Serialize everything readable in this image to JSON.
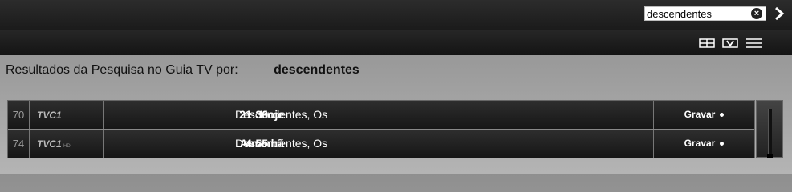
{
  "search": {
    "value": "descendentes",
    "clear_icon": "clear-icon",
    "go_icon": "chevron-right-icon"
  },
  "toolbar": {
    "icons": [
      "grid-view-icon",
      "record-list-icon",
      "list-view-icon"
    ]
  },
  "heading": {
    "label": "Resultados da Pesquisa no Guia TV por:",
    "term": "descendentes"
  },
  "results": [
    {
      "channel_number": "70",
      "channel_logo": "TVC1",
      "day": "Hoje",
      "time": "21:30",
      "title": "Descendentes, Os",
      "action": "Gravar"
    },
    {
      "channel_number": "74",
      "channel_logo": "TVC1 HD",
      "day": "Amanhã",
      "time": "4:55",
      "title": "Descendentes, Os",
      "action": "Gravar"
    }
  ],
  "colors": {
    "bar_dark": "#1b1b1b",
    "row_dark": "#222222",
    "page_bg": "#9c9c9c"
  }
}
